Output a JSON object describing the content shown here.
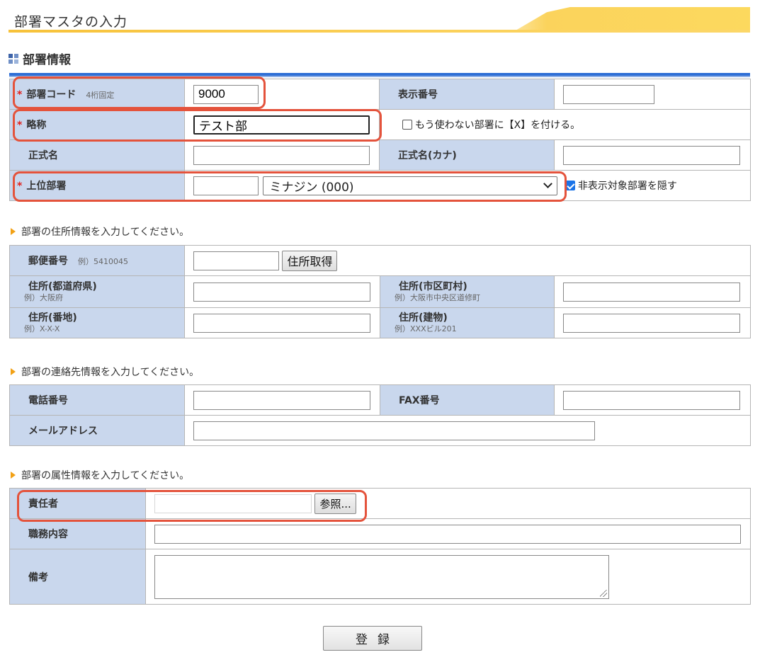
{
  "header": {
    "title": "部署マスタの入力"
  },
  "section": {
    "title": "部署情報"
  },
  "basic": {
    "dept_code": {
      "label": "部署コード",
      "hint": "4桁固定",
      "value": "9000",
      "required": "*"
    },
    "display_no": {
      "label": "表示番号",
      "value": ""
    },
    "abbr": {
      "label": "略称",
      "value": "テスト部",
      "required": "*"
    },
    "unused_check": {
      "label": "もう使わない部署に【X】を付ける。",
      "checked": false
    },
    "formal_name": {
      "label": "正式名",
      "value": ""
    },
    "formal_kana": {
      "label": "正式名(カナ)",
      "value": ""
    },
    "parent": {
      "label": "上位部署",
      "code": "",
      "selected": "ミナジン (000)",
      "required": "*"
    },
    "hide_check": {
      "label": "非表示対象部署を隠す",
      "checked": true
    }
  },
  "address_note": "部署の住所情報を入力してください。",
  "address": {
    "zip": {
      "label": "郵便番号",
      "hint": "例）5410045",
      "value": "",
      "button": "住所取得"
    },
    "pref": {
      "label": "住所(都道府県)",
      "example": "例）大阪府",
      "value": ""
    },
    "city": {
      "label": "住所(市区町村)",
      "example": "例）大阪市中央区道修町",
      "value": ""
    },
    "street": {
      "label": "住所(番地)",
      "example": "例）X-X-X",
      "value": ""
    },
    "building": {
      "label": "住所(建物)",
      "example": "例）XXXビル201",
      "value": ""
    }
  },
  "contact_note": "部署の連絡先情報を入力してください。",
  "contact": {
    "tel": {
      "label": "電話番号",
      "value": ""
    },
    "fax": {
      "label": "FAX番号",
      "value": ""
    },
    "mail": {
      "label": "メールアドレス",
      "value": ""
    }
  },
  "attr_note": "部署の属性情報を入力してください。",
  "attr": {
    "manager": {
      "label": "責任者",
      "value": "",
      "button": "参照..."
    },
    "duty": {
      "label": "職務内容",
      "value": ""
    },
    "remarks": {
      "label": "備考",
      "value": ""
    }
  },
  "submit": {
    "label": "登録"
  },
  "colors": {
    "label_bg": "#c9d7ed",
    "highlight": "#e4533c",
    "accent": "#2f6fd6",
    "required": "#e0201c"
  }
}
